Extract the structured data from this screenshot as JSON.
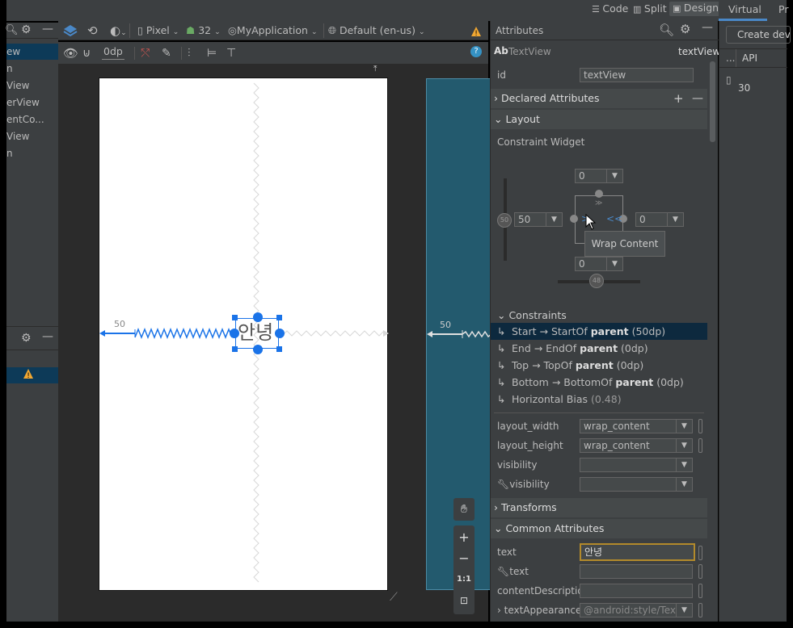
{
  "top_tabs": {
    "code": "Code",
    "split": "Split",
    "design": "Design",
    "virtual": "Virtual",
    "pr": "Pr"
  },
  "toolbar": {
    "device": "Pixel",
    "api": "32",
    "theme": "MyApplication",
    "locale": "Default (en-us)",
    "margin": "0dp"
  },
  "left_tree": [
    "ew",
    "n",
    "View",
    "erView",
    "entCo...",
    "View",
    "n"
  ],
  "left_panel": {
    "warning_icon": "warning-icon"
  },
  "canvas": {
    "text": "안녕",
    "margin_label": "50",
    "blueprint_margin_label": "50",
    "zoom_one": "1:1"
  },
  "attributes": {
    "title": "Attributes",
    "widget_type": "TextView",
    "widget_id": "textView",
    "id_label": "id",
    "id_value": "textView",
    "declared": "Declared Attributes",
    "layout": "Layout",
    "constraint_widget": "Constraint Widget",
    "top_margin": "0",
    "left_margin": "50",
    "right_margin": "0",
    "bottom_margin": "0",
    "vbias": "50",
    "hbias": "48",
    "tooltip": "Wrap Content",
    "constraints": "Constraints",
    "constraint_items": [
      {
        "pre": "Start → StartOf ",
        "bold": "parent",
        "post": " (50dp)"
      },
      {
        "pre": "End → EndOf ",
        "bold": "parent",
        "post": " (0dp)"
      },
      {
        "pre": "Top → TopOf ",
        "bold": "parent",
        "post": " (0dp)"
      },
      {
        "pre": "Bottom → BottomOf ",
        "bold": "parent",
        "post": " (0dp)"
      },
      {
        "pre": "Horizontal Bias ",
        "bold": "",
        "post": "(0.48)"
      }
    ],
    "layout_width_label": "layout_width",
    "layout_width": "wrap_content",
    "layout_height_label": "layout_height",
    "layout_height": "wrap_content",
    "visibility_label": "visibility",
    "tools_visibility_label": "visibility",
    "transforms": "Transforms",
    "common": "Common Attributes",
    "text_label": "text",
    "text_value": "안녕",
    "tools_text_label": "text",
    "content_desc_label": "contentDescription",
    "text_appearance_label": "textAppearance",
    "text_appearance_value": "@android:style/Text"
  },
  "right_panel": {
    "create_device": "Create devic",
    "api_col": "API",
    "api_value": "30"
  }
}
